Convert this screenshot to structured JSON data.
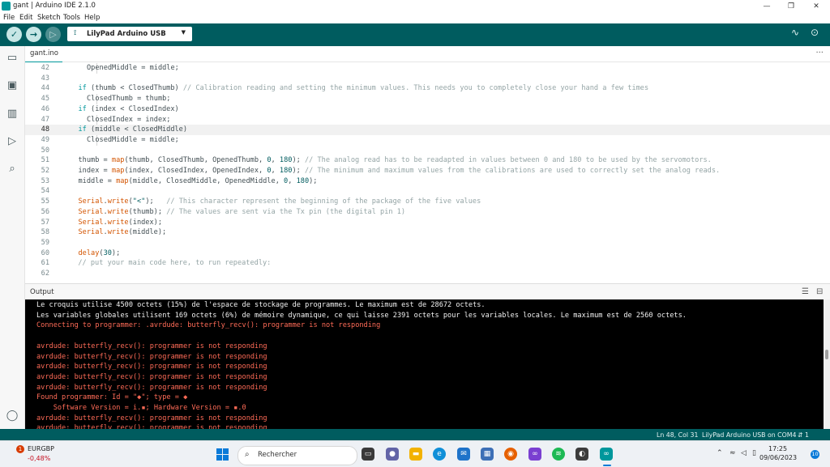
{
  "window": {
    "title": "gant | Arduino IDE 2.1.0",
    "controls": [
      "—",
      "❐",
      "✕"
    ]
  },
  "menu": [
    "File",
    "Edit",
    "Sketch",
    "Tools",
    "Help"
  ],
  "toolbar": {
    "board": "LilyPad Arduino USB"
  },
  "tab": {
    "label": "gant.ino",
    "more": "···"
  },
  "editor": {
    "current_line": "48",
    "lines": [
      {
        "n": "42",
        "indent": 2,
        "seg": [
          [
            "",
            "OpenedMiddle = middle;"
          ]
        ]
      },
      {
        "n": "43",
        "indent": 1,
        "seg": []
      },
      {
        "n": "44",
        "indent": 1,
        "seg": [
          [
            "kw",
            "if"
          ],
          [
            "",
            " (thumb < ClosedThumb) "
          ],
          [
            "cm",
            "// Calibration reading and setting the minimum values. This needs you to completely close your hand a few times"
          ]
        ]
      },
      {
        "n": "45",
        "indent": 2,
        "seg": [
          [
            "",
            "ClosedThumb = thumb;"
          ]
        ]
      },
      {
        "n": "46",
        "indent": 1,
        "seg": [
          [
            "kw",
            "if"
          ],
          [
            "",
            " (index < ClosedIndex)"
          ]
        ]
      },
      {
        "n": "47",
        "indent": 2,
        "seg": [
          [
            "",
            "ClosedIndex = index;"
          ]
        ]
      },
      {
        "n": "48",
        "indent": 1,
        "seg": [
          [
            "kw",
            "if"
          ],
          [
            "",
            " (middle < ClosedMiddle)"
          ]
        ]
      },
      {
        "n": "49",
        "indent": 2,
        "seg": [
          [
            "",
            "ClosedMiddle = middle;"
          ]
        ]
      },
      {
        "n": "50",
        "indent": 1,
        "seg": []
      },
      {
        "n": "51",
        "indent": 1,
        "seg": [
          [
            "",
            "thumb = "
          ],
          [
            "fn",
            "map"
          ],
          [
            "",
            "(thumb, ClosedThumb, OpenedThumb, "
          ],
          [
            "num",
            "0"
          ],
          [
            "",
            ", "
          ],
          [
            "num",
            "180"
          ],
          [
            "",
            "); "
          ],
          [
            "cm",
            "// The analog read has to be readapted in values between 0 and 180 to be used by the servomotors."
          ]
        ]
      },
      {
        "n": "52",
        "indent": 1,
        "seg": [
          [
            "",
            "index = "
          ],
          [
            "fn",
            "map"
          ],
          [
            "",
            "(index, ClosedIndex, OpenedIndex, "
          ],
          [
            "num",
            "0"
          ],
          [
            "",
            ", "
          ],
          [
            "num",
            "180"
          ],
          [
            "",
            "); "
          ],
          [
            "cm",
            "// The minimum and maximum values from the calibrations are used to correctly set the analog reads."
          ]
        ]
      },
      {
        "n": "53",
        "indent": 1,
        "seg": [
          [
            "",
            "middle = "
          ],
          [
            "fn",
            "map"
          ],
          [
            "",
            "(middle, ClosedMiddle, OpenedMiddle, "
          ],
          [
            "num",
            "0"
          ],
          [
            "",
            ", "
          ],
          [
            "num",
            "180"
          ],
          [
            "",
            ");"
          ]
        ]
      },
      {
        "n": "54",
        "indent": 1,
        "seg": []
      },
      {
        "n": "55",
        "indent": 1,
        "seg": [
          [
            "fn",
            "Serial"
          ],
          [
            "",
            "."
          ],
          [
            "fn",
            "write"
          ],
          [
            "",
            "("
          ],
          [
            "str",
            "\"<\""
          ],
          [
            "",
            ");   "
          ],
          [
            "cm",
            "// This character represent the beginning of the package of the five values"
          ]
        ]
      },
      {
        "n": "56",
        "indent": 1,
        "seg": [
          [
            "fn",
            "Serial"
          ],
          [
            "",
            "."
          ],
          [
            "fn",
            "write"
          ],
          [
            "",
            "(thumb); "
          ],
          [
            "cm",
            "// The values are sent via the Tx pin (the digital pin 1)"
          ]
        ]
      },
      {
        "n": "57",
        "indent": 1,
        "seg": [
          [
            "fn",
            "Serial"
          ],
          [
            "",
            "."
          ],
          [
            "fn",
            "write"
          ],
          [
            "",
            "(index);"
          ]
        ]
      },
      {
        "n": "58",
        "indent": 1,
        "seg": [
          [
            "fn",
            "Serial"
          ],
          [
            "",
            "."
          ],
          [
            "fn",
            "write"
          ],
          [
            "",
            "(middle);"
          ]
        ]
      },
      {
        "n": "59",
        "indent": 1,
        "seg": []
      },
      {
        "n": "60",
        "indent": 1,
        "seg": [
          [
            "fn",
            "delay"
          ],
          [
            "",
            "("
          ],
          [
            "num",
            "30"
          ],
          [
            "",
            ");"
          ]
        ]
      },
      {
        "n": "61",
        "indent": 0,
        "seg": [
          [
            "cm",
            "  // put your main code here, to run repeatedly:"
          ]
        ]
      },
      {
        "n": "62",
        "indent": 0,
        "seg": []
      }
    ]
  },
  "output": {
    "title": "Output",
    "lines": [
      {
        "t": "white",
        "text": "Le croquis utilise 4500 octets (15%) de l'espace de stockage de programmes. Le maximum est de 28672 octets."
      },
      {
        "t": "white",
        "text": "Les variables globales utilisent 169 octets (6%) de mémoire dynamique, ce qui laisse 2391 octets pour les variables locales. Le maximum est de 2560 octets."
      },
      {
        "t": "err",
        "text": "Connecting to programmer: .avrdude: butterfly_recv(): programmer is not responding"
      },
      {
        "t": "err",
        "text": ""
      },
      {
        "t": "err",
        "text": "avrdude: butterfly_recv(): programmer is not responding"
      },
      {
        "t": "err",
        "text": "avrdude: butterfly_recv(): programmer is not responding"
      },
      {
        "t": "err",
        "text": "avrdude: butterfly_recv(): programmer is not responding"
      },
      {
        "t": "err",
        "text": "avrdude: butterfly_recv(): programmer is not responding"
      },
      {
        "t": "err",
        "text": "avrdude: butterfly_recv(): programmer is not responding"
      },
      {
        "t": "err",
        "text": "Found programmer: Id = \"◆\"; type = ◆"
      },
      {
        "t": "err",
        "text": "    Software Version = i.▪; Hardware Version = ▪.0"
      },
      {
        "t": "err",
        "text": "avrdude: butterfly_recv(): programmer is not responding"
      },
      {
        "t": "err",
        "text": "avrdude: butterfly_recv(): programmer is not responding"
      }
    ]
  },
  "status": {
    "position": "Ln 48, Col 31",
    "board_port": "LilyPad Arduino USB on COM4",
    "notifications": "1"
  },
  "taskbar": {
    "widget_badge": "1",
    "ticker_name": "EURGBP",
    "ticker_change": "-0,48%",
    "search_label": "Rechercher",
    "time": "17:25",
    "date": "09/06/2023",
    "notif_count": "10"
  },
  "colors": {
    "teal_dark": "#005c5f",
    "teal": "#00979c",
    "error": "#ff6b57"
  }
}
